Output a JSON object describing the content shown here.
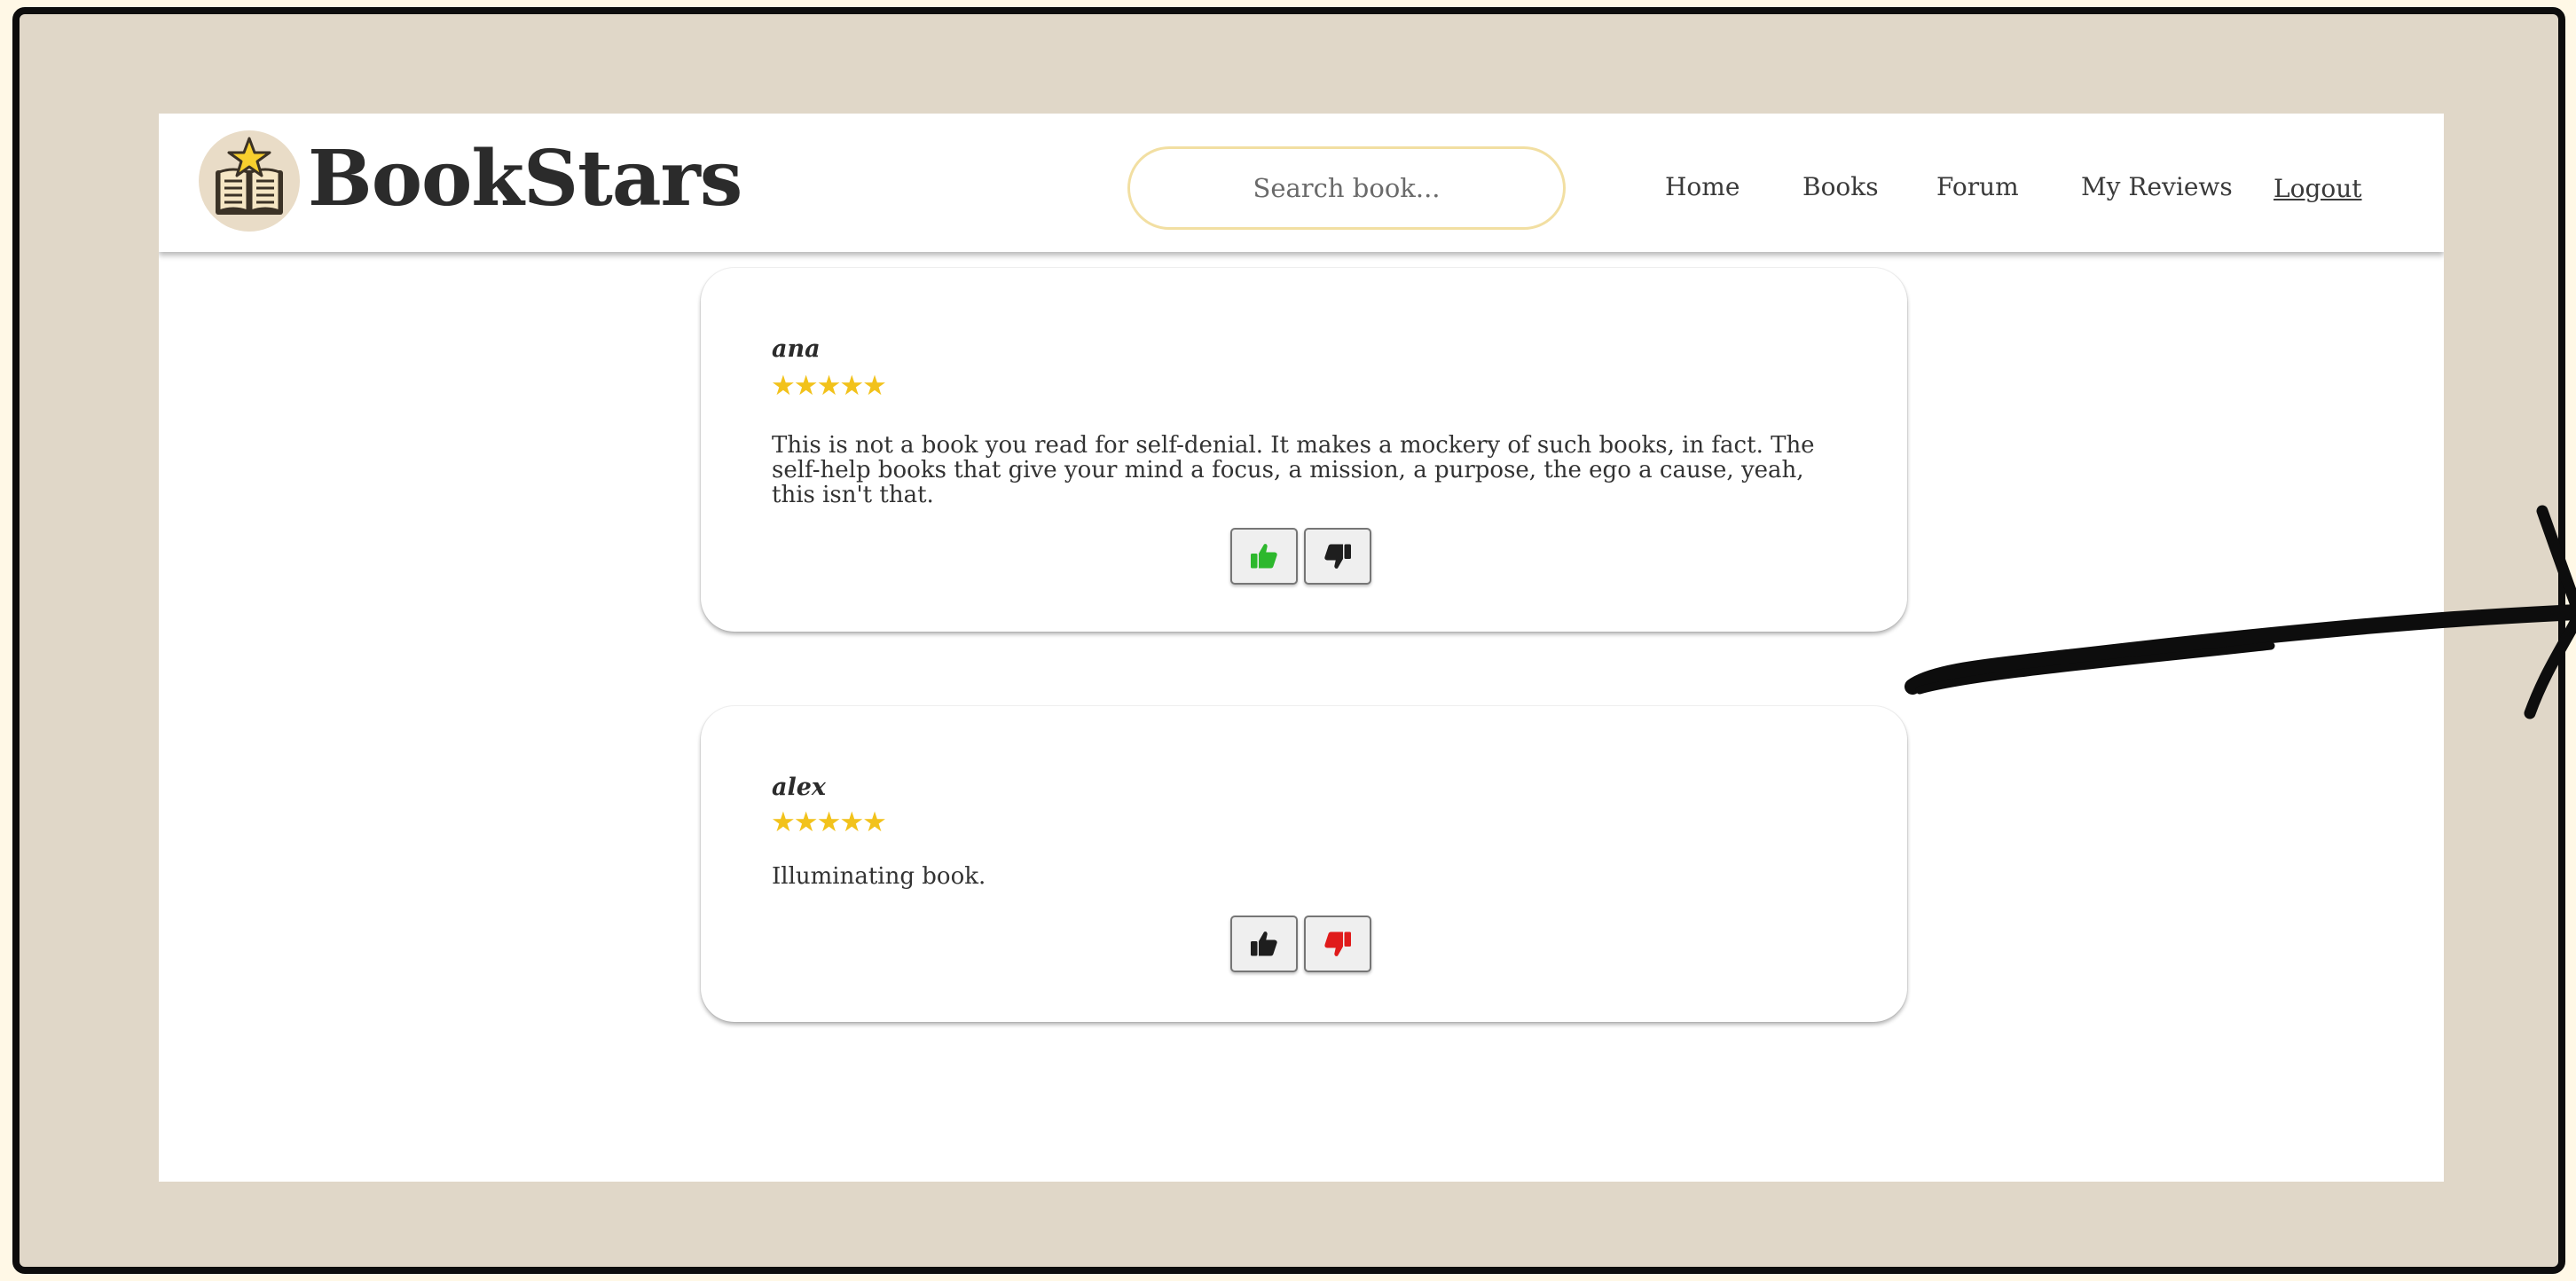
{
  "brand": {
    "name": "BookStars",
    "logo_icon": "book-star-logo-icon"
  },
  "search": {
    "placeholder": "Search book..."
  },
  "nav": {
    "home": "Home",
    "books": "Books",
    "forum": "Forum",
    "my_reviews": "My Reviews",
    "logout": "Logout"
  },
  "reviews": [
    {
      "user": "ana",
      "stars": "★★★★★",
      "rating": 5,
      "text": "This is not a book you read for self-denial. It makes a mockery of such books, in fact. The self-help books that give your mind a focus, a mission, a purpose, the ego a cause, yeah, this isn't that.",
      "like_active": true,
      "dislike_active": false
    },
    {
      "user": "alex",
      "stars": "★★★★★",
      "rating": 5,
      "text": "Illuminating book.",
      "like_active": false,
      "dislike_active": true
    }
  ],
  "colors": {
    "outer_background": "#e0d7c8",
    "star": "#f2c21b",
    "like_active": "#2db82d",
    "dislike_active": "#e01b1b",
    "inactive_icon": "#1e1e1e",
    "search_border": "#f2dfa2"
  }
}
